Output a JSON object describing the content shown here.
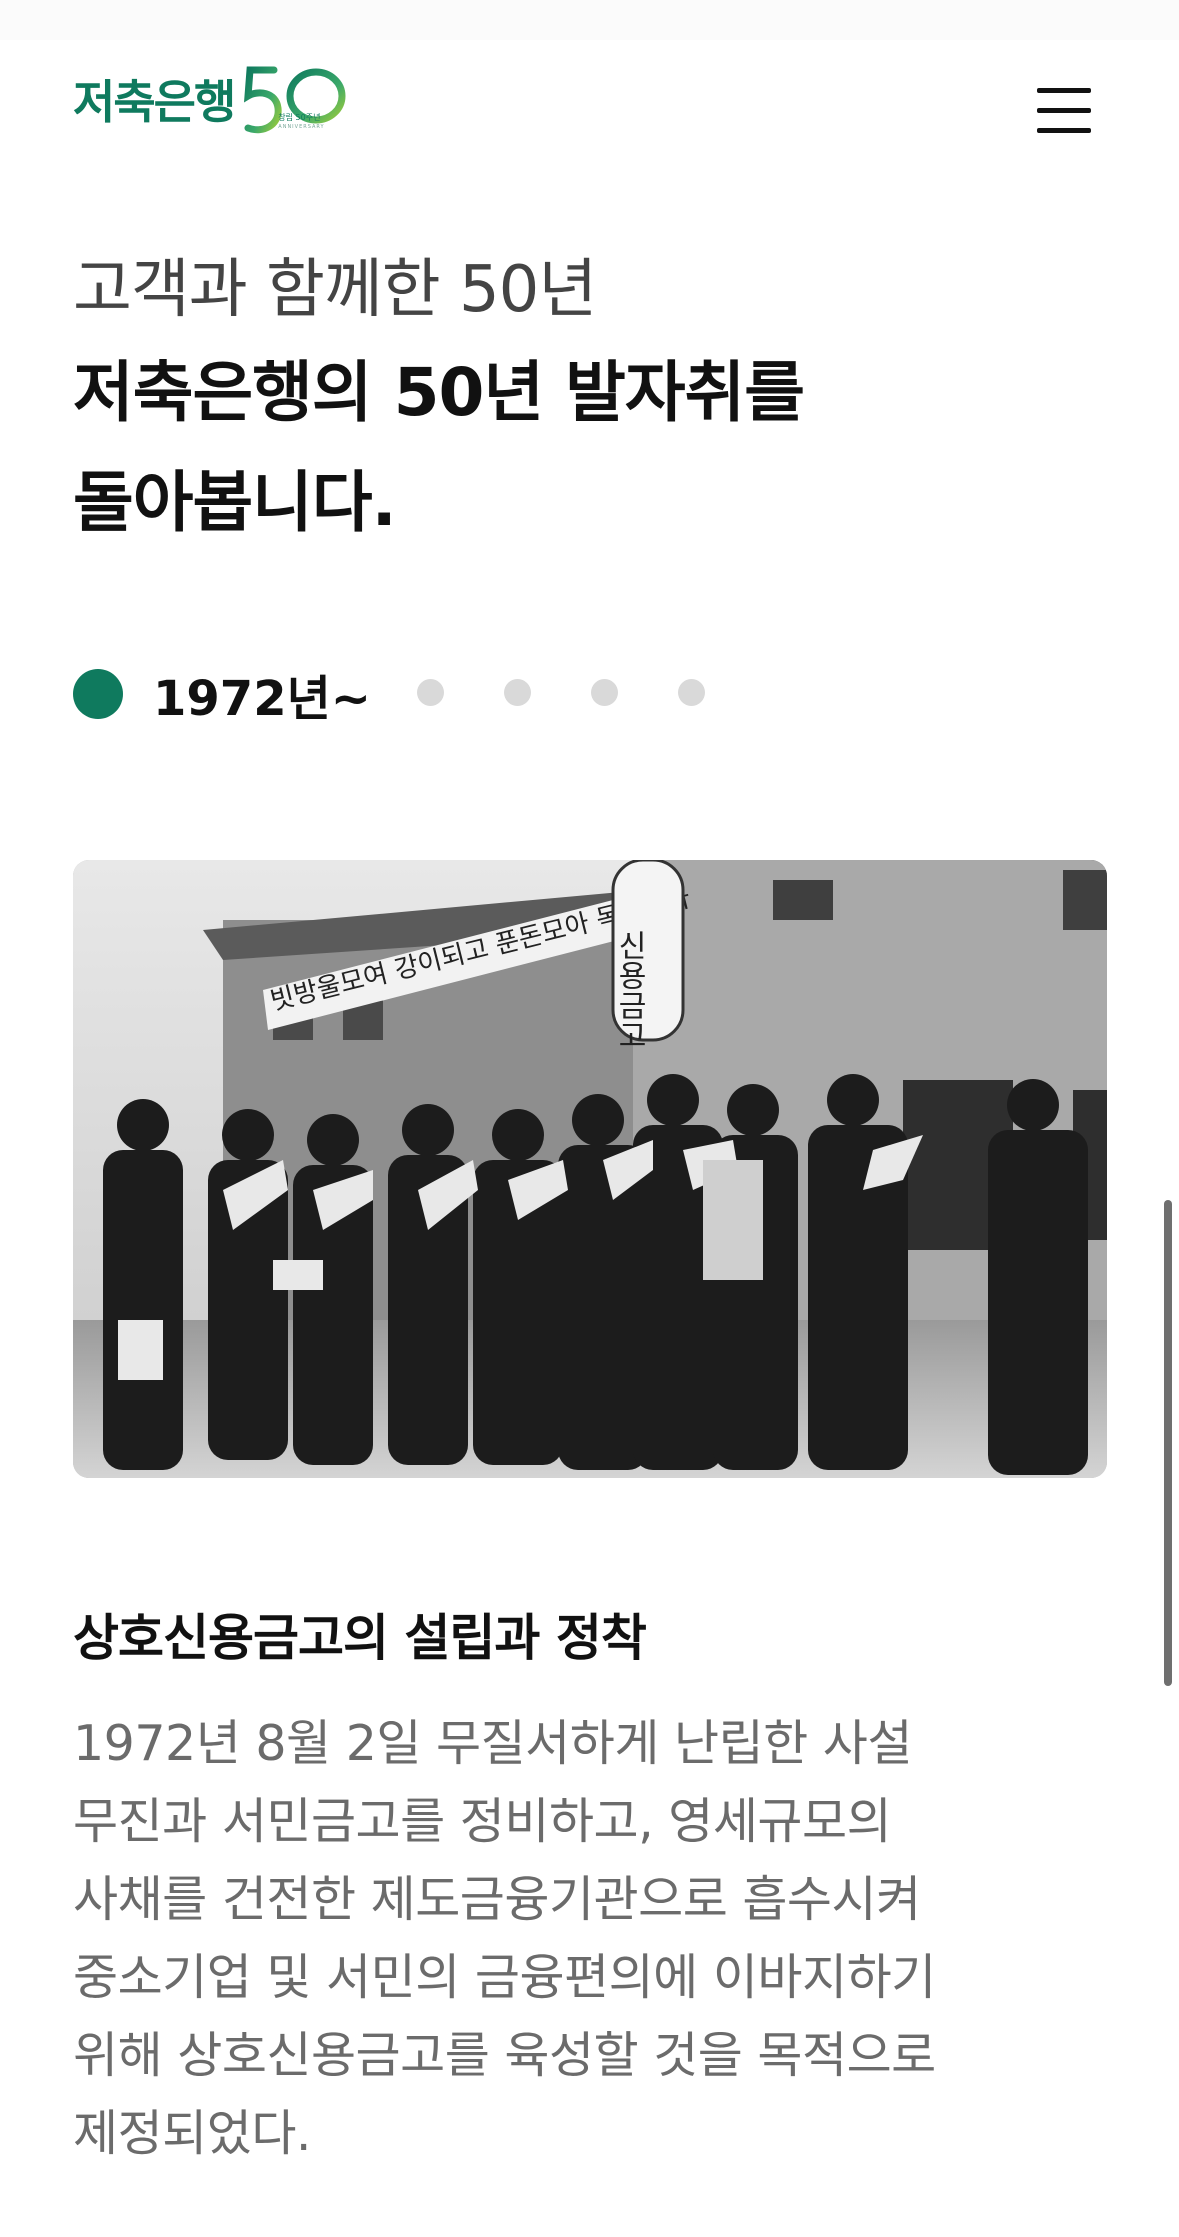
{
  "header": {
    "logo_text": "저축은행",
    "logo_badge_number": "50",
    "logo_badge_sub": "창립 50주년",
    "logo_badge_tag": "ANNIVERSARY",
    "brand_color": "#0f7a5e",
    "menu_icon": "hamburger-menu-icon"
  },
  "intro": {
    "subtitle": "고객과 함께한 50년",
    "title_line1": "저축은행의 50년 발자취를",
    "title_line2": "돌아봅니다."
  },
  "timeline": {
    "active_label": "1972년~",
    "active_color": "#0f7a5e",
    "inactive_color": "#d9d9d9",
    "total_steps": 5,
    "active_index": 0
  },
  "photo": {
    "banner_text": "빗방울모여 강이되고 푼돈모아 목돈된다",
    "sign_text": "신용금고"
  },
  "section": {
    "title": "상호신용금고의 설립과 정착",
    "body_lines": [
      "1972년 8월 2일 무질서하게 난립한 사설",
      "무진과 서민금고를 정비하고, 영세규모의",
      "사채를 건전한 제도금융기관으로 흡수시켜",
      "중소기업 및 서민의 금융편의에 이바지하기",
      "위해 상호신용금고를 육성할 것을 목적으로",
      "제정되었다."
    ]
  }
}
